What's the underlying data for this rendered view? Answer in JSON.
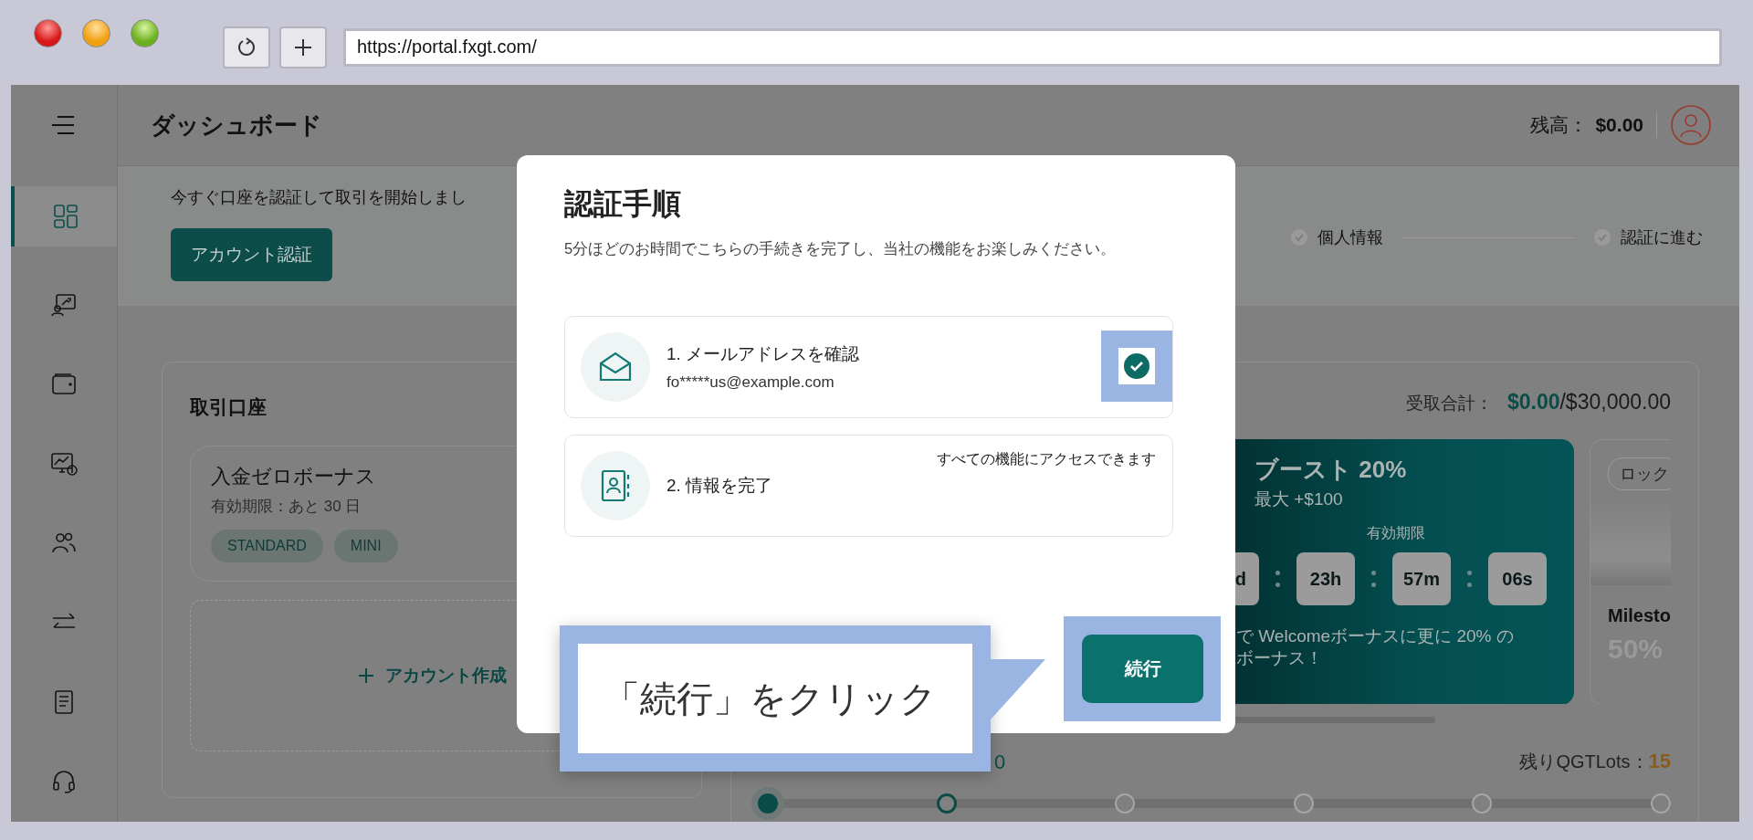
{
  "browser": {
    "url": "https://portal.fxgt.com/"
  },
  "sidebar": {
    "items": [
      {
        "kind": "dashboard",
        "selected": true
      },
      {
        "kind": "accounts",
        "selected": false
      },
      {
        "kind": "wallet",
        "selected": false
      },
      {
        "kind": "earnings",
        "selected": false
      },
      {
        "kind": "partners",
        "selected": false
      },
      {
        "kind": "transfer",
        "selected": false
      },
      {
        "kind": "document",
        "selected": false
      },
      {
        "kind": "support",
        "selected": false
      }
    ]
  },
  "header": {
    "title": "ダッシュボード",
    "balance_label": "残高：",
    "balance": "$0.00"
  },
  "banner": {
    "text": "今すぐ口座を認証して取引を開始しまし",
    "button": "アカウント認証",
    "steps": [
      "個人情報",
      "認証に進む"
    ]
  },
  "accounts": {
    "title": "取引口座",
    "cards": [
      {
        "name": "入金ゼロボーナス",
        "expiry": "有効期限：あと 30 日",
        "tags": [
          "STANDARD",
          "MINI"
        ]
      }
    ],
    "create": "アカウント作成"
  },
  "bonus": {
    "total_label": "受取合計：",
    "total_received": "$0.00",
    "total_max": "/$30,000.00",
    "promo": {
      "title": "ブースト 20%",
      "subtitle": "最大 +$100",
      "expiry_label": "有効期限",
      "countdown": [
        "d",
        "23h",
        "57m",
        "06s"
      ],
      "text_lines": [
        "で Welcomeボーナスに更に 20% の",
        "ボーナス！"
      ]
    },
    "milestone": {
      "tag": "ロック",
      "title": "Milesto",
      "value": "50%"
    },
    "partial_value": "0",
    "remaining_label": "残りQGTLots：",
    "remaining": "15",
    "nodes": [
      {
        "kind": "reached"
      },
      {
        "kind": "next"
      },
      {
        "kind": "pending"
      },
      {
        "kind": "pending"
      },
      {
        "kind": "pending"
      },
      {
        "kind": "pending"
      }
    ]
  },
  "modal": {
    "title": "認証手順",
    "subtitle": "5分ほどのお時間でこちらの手続きを完了し、当社の機能をお楽しみください。",
    "steps": [
      {
        "kind": "email",
        "title": "1. メールアドレスを確認",
        "detail": "fo*****us@example.com",
        "completed": true
      },
      {
        "kind": "profile",
        "title": "2. 情報を完了",
        "note": "すべての機能にアクセスできます",
        "completed": false
      }
    ],
    "button": "続行"
  },
  "annotation": {
    "text": "「続行」をクリック"
  }
}
